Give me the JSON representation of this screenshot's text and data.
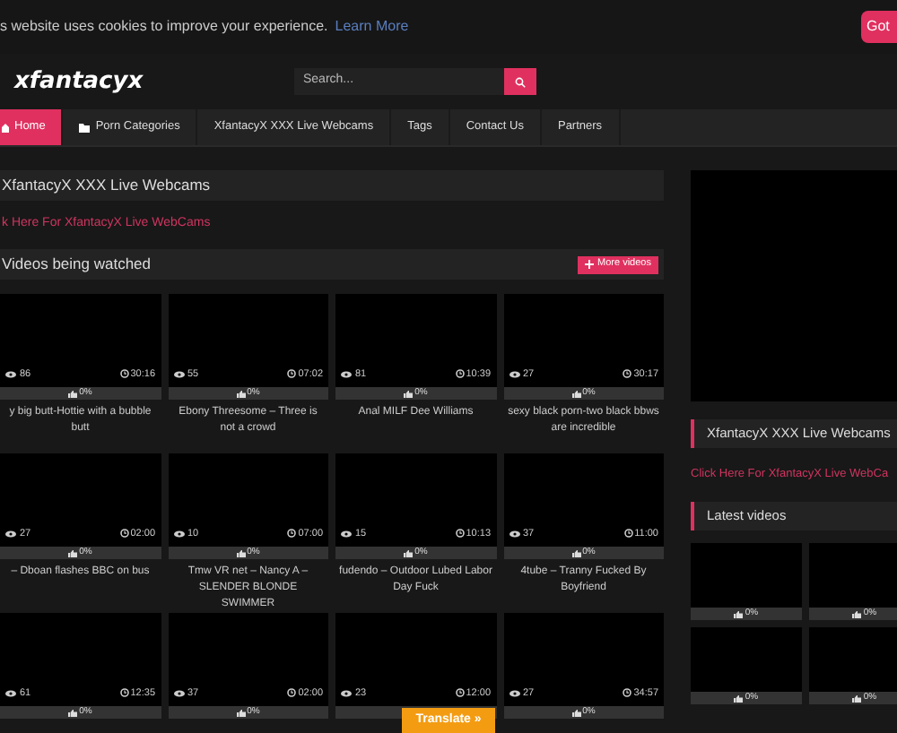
{
  "cookie_bar": {
    "text": "s website uses cookies to improve your experience.",
    "link": "Learn More",
    "button": "Got"
  },
  "header": {
    "logo": "xfantacyx",
    "search": {
      "placeholder": "Search..."
    }
  },
  "nav": [
    {
      "label": "Home",
      "selected": true,
      "kind": "home"
    },
    {
      "label": "Porn Categories",
      "selected": false,
      "kind": "folder"
    },
    {
      "label": "XfantacyX XXX Live Webcams",
      "selected": false
    },
    {
      "label": "Tags",
      "selected": false
    },
    {
      "label": "Contact Us",
      "selected": false
    },
    {
      "label": "Partners",
      "selected": false
    }
  ],
  "main": {
    "webcams_title": "XfantacyX XXX Live Webcams",
    "webcams_link": "k Here For XfantacyX Live WebCams",
    "videos_title": "Videos being watched",
    "more_button": "More videos",
    "videos": [
      {
        "views": "86",
        "duration": "30:16",
        "rating": "0%",
        "title": "y big butt-Hottie with a bubble butt"
      },
      {
        "views": "55",
        "duration": "07:02",
        "rating": "0%",
        "title": "Ebony Threesome – Three is not a crowd"
      },
      {
        "views": "81",
        "duration": "10:39",
        "rating": "0%",
        "title": "Anal MILF Dee Williams"
      },
      {
        "views": "27",
        "duration": "30:17",
        "rating": "0%",
        "title": "sexy black porn-two black bbws are incredible"
      },
      {
        "views": "27",
        "duration": "02:00",
        "rating": "0%",
        "title": "– Dboan flashes BBC on bus"
      },
      {
        "views": "10",
        "duration": "07:00",
        "rating": "0%",
        "title": "Tmw VR net – Nancy A – SLENDER BLONDE SWIMMER"
      },
      {
        "views": "15",
        "duration": "10:13",
        "rating": "0%",
        "title": "fudendo – Outdoor Lubed Labor Day Fuck"
      },
      {
        "views": "37",
        "duration": "11:00",
        "rating": "0%",
        "title": "4tube – Tranny Fucked By Boyfriend"
      },
      {
        "views": "61",
        "duration": "12:35",
        "rating": "0%"
      },
      {
        "views": "37",
        "duration": "02:00",
        "rating": "0%"
      },
      {
        "views": "23",
        "duration": "12:00"
      },
      {
        "views": "27",
        "duration": "34:57",
        "rating": "0%"
      }
    ]
  },
  "sidebar": {
    "webcams_title": "XfantacyX XXX Live Webcams",
    "webcams_link": "Click Here For XfantacyX Live WebCa",
    "latest_title": "Latest videos",
    "latest": [
      {
        "rating": "0%"
      },
      {
        "rating": "0%"
      },
      {
        "rating": "0%"
      },
      {
        "rating": "0%"
      }
    ]
  },
  "translate_button": "Translate »"
}
